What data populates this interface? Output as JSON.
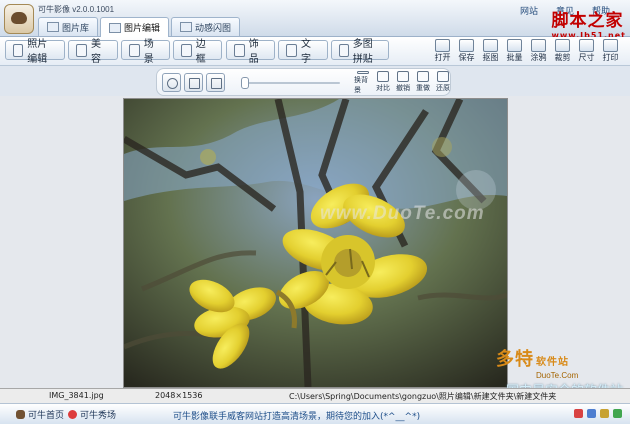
{
  "window": {
    "title": "可牛影像 v2.0.0.1001",
    "tabs": [
      {
        "label": "图片库"
      },
      {
        "label": "图片编辑"
      },
      {
        "label": "动感闪图"
      }
    ],
    "top_links": [
      "网站",
      "意见",
      "帮助"
    ]
  },
  "corner_watermark": {
    "title": "脚本之家",
    "url": "www.Jb51.net"
  },
  "toolbar": {
    "left_buttons": [
      "照片编辑",
      "美 容",
      "场 景",
      "边 框",
      "饰 品",
      "文 字",
      "多图拼贴"
    ],
    "right_buttons": [
      "打开",
      "保存",
      "抠图",
      "批量",
      "涂鸦",
      "裁剪",
      "尺寸",
      "打印"
    ]
  },
  "secondary_toolbar": {
    "actions": [
      "换背景",
      "对比",
      "撤销",
      "重做",
      "还原"
    ]
  },
  "canvas": {
    "watermark": "www.DuoTe.com"
  },
  "overlay": {
    "brand": "多特",
    "brand_suffix": "软件站",
    "url": "DuoTe.Com",
    "slogan": "国内最安全的软件站"
  },
  "status": {
    "filename": "IMG_3841.jpg",
    "dimensions": "2048×1536",
    "path": "C:\\Users\\Spring\\Documents\\gongzuo\\照片编辑\\新建文件夹\\新建文件夹"
  },
  "bottom": {
    "home": "可牛首页",
    "showcase": "可牛秀场",
    "message": "可牛影像联手威客网站打造高清场景，期待您的加入(*^__^*)"
  },
  "colors": {
    "accent": "#2d67b8",
    "warning_red": "#c20000",
    "flower_yellow": "#e3cf2f"
  }
}
